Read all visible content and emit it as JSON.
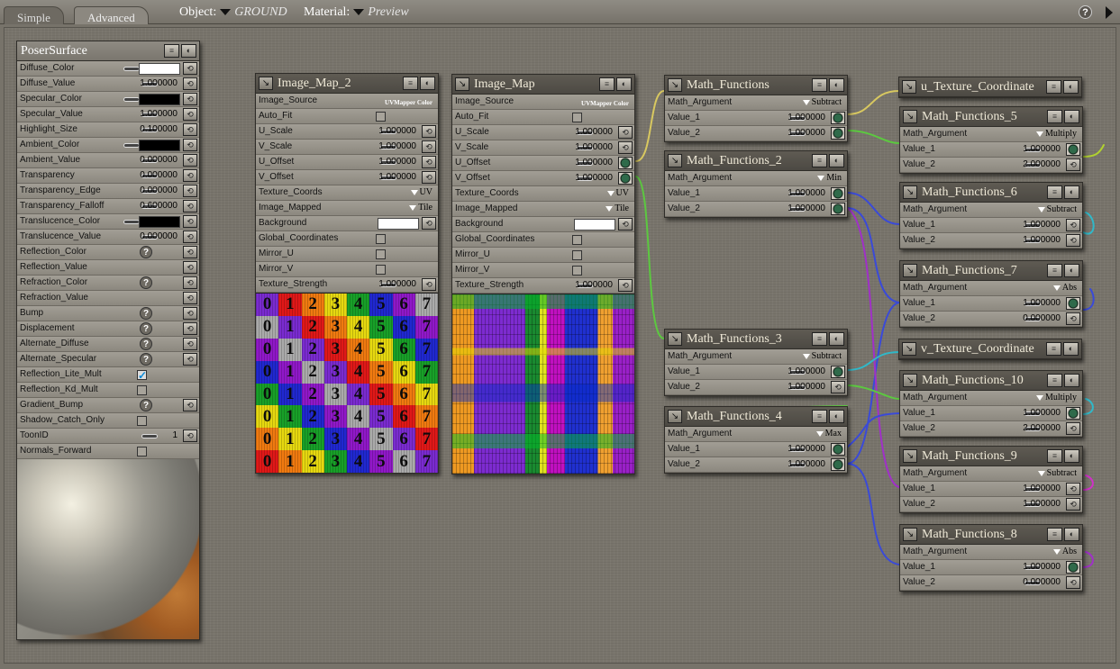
{
  "topbar": {
    "tabs": [
      {
        "label": "Simple"
      },
      {
        "label": "Advanced"
      }
    ],
    "object_label": "Object:",
    "object_value": "GROUND",
    "material_label": "Material:",
    "material_value": "Preview",
    "help": "?"
  },
  "colors": {
    "wire_yellow": "#d8c860",
    "wire_green": "#5cc840",
    "wire_blue": "#3a4ad8",
    "wire_cyan": "#30b8c8",
    "wire_purple": "#a030c8",
    "wire_magenta": "#d030c8",
    "wire_lime": "#b0d030"
  },
  "poser_surface": {
    "title": "PoserSurface",
    "rows": [
      {
        "label": "Diffuse_Color"
      },
      {
        "label": "Diffuse_Value",
        "value": "1.000000"
      },
      {
        "label": "Specular_Color"
      },
      {
        "label": "Specular_Value",
        "value": "1.000000"
      },
      {
        "label": "Highlight_Size",
        "value": "0.100000"
      },
      {
        "label": "Ambient_Color"
      },
      {
        "label": "Ambient_Value",
        "value": "0.000000"
      },
      {
        "label": "Transparency",
        "value": "0.000000"
      },
      {
        "label": "Transparency_Edge",
        "value": "0.000000"
      },
      {
        "label": "Transparency_Falloff",
        "value": "0.600000"
      },
      {
        "label": "Translucence_Color"
      },
      {
        "label": "Translucence_Value",
        "value": "0.000000"
      },
      {
        "label": "Reflection_Color"
      },
      {
        "label": "Reflection_Value"
      },
      {
        "label": "Refraction_Color"
      },
      {
        "label": "Refraction_Value"
      },
      {
        "label": "Bump"
      },
      {
        "label": "Displacement"
      },
      {
        "label": "Alternate_Diffuse"
      },
      {
        "label": "Alternate_Specular"
      },
      {
        "label": "Reflection_Lite_Mult"
      },
      {
        "label": "Reflection_Kd_Mult"
      },
      {
        "label": "Gradient_Bump"
      },
      {
        "label": "Shadow_Catch_Only"
      },
      {
        "label": "ToonID",
        "value": "1"
      },
      {
        "label": "Normals_Forward"
      }
    ]
  },
  "image_map_2": {
    "title": "Image_Map_2",
    "rows": [
      {
        "label": "Image_Source",
        "value": "UVMapper Color"
      },
      {
        "label": "Auto_Fit"
      },
      {
        "label": "U_Scale",
        "value": "1.000000"
      },
      {
        "label": "V_Scale",
        "value": "1.000000"
      },
      {
        "label": "U_Offset",
        "value": "1.000000"
      },
      {
        "label": "V_Offset",
        "value": "1.000000"
      },
      {
        "label": "Texture_Coords",
        "value": "UV"
      },
      {
        "label": "Image_Mapped",
        "value": "Tile"
      },
      {
        "label": "Background"
      },
      {
        "label": "Global_Coordinates"
      },
      {
        "label": "Mirror_U"
      },
      {
        "label": "Mirror_V"
      },
      {
        "label": "Texture_Strength",
        "value": "1.000000"
      }
    ],
    "texture_digits": [
      "0",
      "1",
      "2",
      "3",
      "4",
      "5",
      "6",
      "7"
    ]
  },
  "image_map": {
    "title": "Image_Map",
    "rows": [
      {
        "label": "Image_Source",
        "value": "UVMapper Color"
      },
      {
        "label": "Auto_Fit"
      },
      {
        "label": "U_Scale",
        "value": "1.000000"
      },
      {
        "label": "V_Scale",
        "value": "1.000000"
      },
      {
        "label": "U_Offset",
        "value": "1.000000"
      },
      {
        "label": "V_Offset",
        "value": "1.000000"
      },
      {
        "label": "Texture_Coords",
        "value": "UV"
      },
      {
        "label": "Image_Mapped",
        "value": "Tile"
      },
      {
        "label": "Background"
      },
      {
        "label": "Global_Coordinates"
      },
      {
        "label": "Mirror_U"
      },
      {
        "label": "Mirror_V"
      },
      {
        "label": "Texture_Strength",
        "value": "1.000000"
      }
    ]
  },
  "math_nodes": [
    {
      "title": "Math_Functions",
      "arg_label": "Math_Argument",
      "arg": "Subtract",
      "v1_label": "Value_1",
      "v1": "1.000000",
      "v2_label": "Value_2",
      "v2": "1.000000"
    },
    {
      "title": "Math_Functions_2",
      "arg_label": "Math_Argument",
      "arg": "Min",
      "v1_label": "Value_1",
      "v1": "1.000000",
      "v2_label": "Value_2",
      "v2": "1.000000"
    },
    {
      "title": "Math_Functions_3",
      "arg_label": "Math_Argument",
      "arg": "Subtract",
      "v1_label": "Value_1",
      "v1": "1.000000",
      "v2_label": "Value_2",
      "v2": "1.000000"
    },
    {
      "title": "Math_Functions_4",
      "arg_label": "Math_Argument",
      "arg": "Max",
      "v1_label": "Value_1",
      "v1": "1.000000",
      "v2_label": "Value_2",
      "v2": "1.000000"
    },
    {
      "title": "Math_Functions_5",
      "arg_label": "Math_Argument",
      "arg": "Multiply",
      "v1_label": "Value_1",
      "v1": "1.000000",
      "v2_label": "Value_2",
      "v2": "2.000000"
    },
    {
      "title": "Math_Functions_6",
      "arg_label": "Math_Argument",
      "arg": "Subtract",
      "v1_label": "Value_1",
      "v1": "1.000000",
      "v2_label": "Value_2",
      "v2": "1.000000"
    },
    {
      "title": "Math_Functions_7",
      "arg_label": "Math_Argument",
      "arg": "Abs",
      "v1_label": "Value_1",
      "v1": "1.000000",
      "v2_label": "Value_2",
      "v2": "0.000000"
    },
    {
      "title": "Math_Functions_10",
      "arg_label": "Math_Argument",
      "arg": "Multiply",
      "v1_label": "Value_1",
      "v1": "1.000000",
      "v2_label": "Value_2",
      "v2": "2.000000"
    },
    {
      "title": "Math_Functions_9",
      "arg_label": "Math_Argument",
      "arg": "Subtract",
      "v1_label": "Value_1",
      "v1": "1.000000",
      "v2_label": "Value_2",
      "v2": "1.000000"
    },
    {
      "title": "Math_Functions_8",
      "arg_label": "Math_Argument",
      "arg": "Abs",
      "v1_label": "Value_1",
      "v1": "1.000000",
      "v2_label": "Value_2",
      "v2": "0.000000"
    }
  ],
  "coord_nodes": [
    {
      "title": "u_Texture_Coordinate"
    },
    {
      "title": "v_Texture_Coordinate"
    }
  ]
}
